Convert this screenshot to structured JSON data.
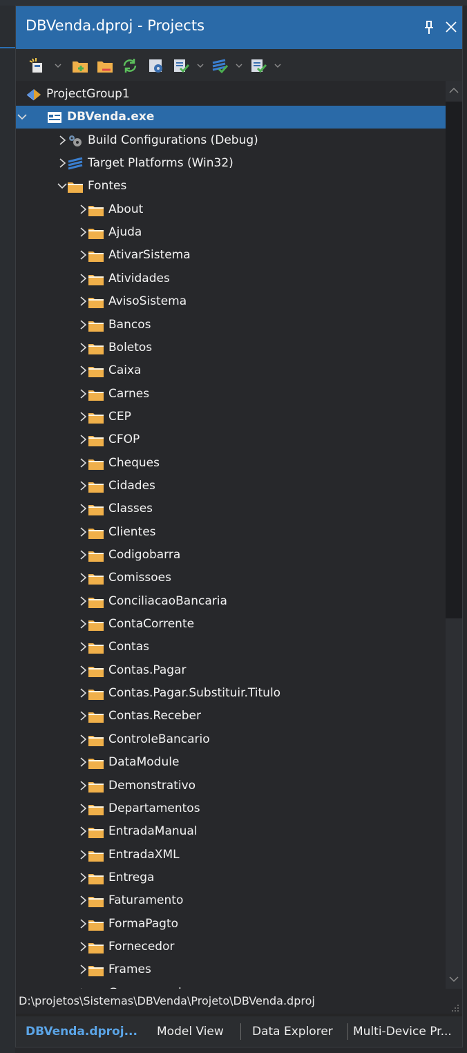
{
  "panel": {
    "title": "DBVenda.dproj - Projects",
    "pin_icon": "pin-icon",
    "close_icon": "close-icon"
  },
  "toolbar": {
    "icons": [
      "new-item-icon",
      "dropdown-arrow-icon",
      "add-to-project-icon",
      "remove-from-project-icon",
      "sync-icon",
      "options-icon",
      "build-icon",
      "dropdown-arrow-icon",
      "build-all-icon",
      "dropdown-arrow-icon",
      "activate-icon",
      "dropdown-arrow-icon"
    ]
  },
  "tree": {
    "group": "ProjectGroup1",
    "project": "DBVenda.exe",
    "build_configurations": "Build Configurations (Debug)",
    "target_platforms": "Target Platforms (Win32)",
    "fontes": "Fontes",
    "folders": [
      "About",
      "Ajuda",
      "AtivarSistema",
      "Atividades",
      "AvisoSistema",
      "Bancos",
      "Boletos",
      "Caixa",
      "Carnes",
      "CEP",
      "CFOP",
      "Cheques",
      "Cidades",
      "Classes",
      "Clientes",
      "Codigobarra",
      "Comissoes",
      "ConciliacaoBancaria",
      "ContaCorrente",
      "Contas",
      "Contas.Pagar",
      "Contas.Pagar.Substituir.Titulo",
      "Contas.Receber",
      "ControleBancario",
      "DataModule",
      "Demonstrativo",
      "Departamentos",
      "EntradaManual",
      "EntradaXML",
      "Entrega",
      "Faturamento",
      "FormaPagto",
      "Fornecedor",
      "Frames",
      "Gerar parcelas"
    ]
  },
  "status": {
    "path": "D:\\projetos\\Sistemas\\DBVenda\\Projeto\\DBVenda.dproj"
  },
  "tabs": [
    "DBVenda.dproj...",
    "Model View",
    "Data Explorer",
    "Multi-Device Pr..."
  ],
  "colors": {
    "accent": "#2a6aa8",
    "background": "#27282b",
    "folder": "#f0b04a",
    "active_tab": "#5ba4e6"
  }
}
